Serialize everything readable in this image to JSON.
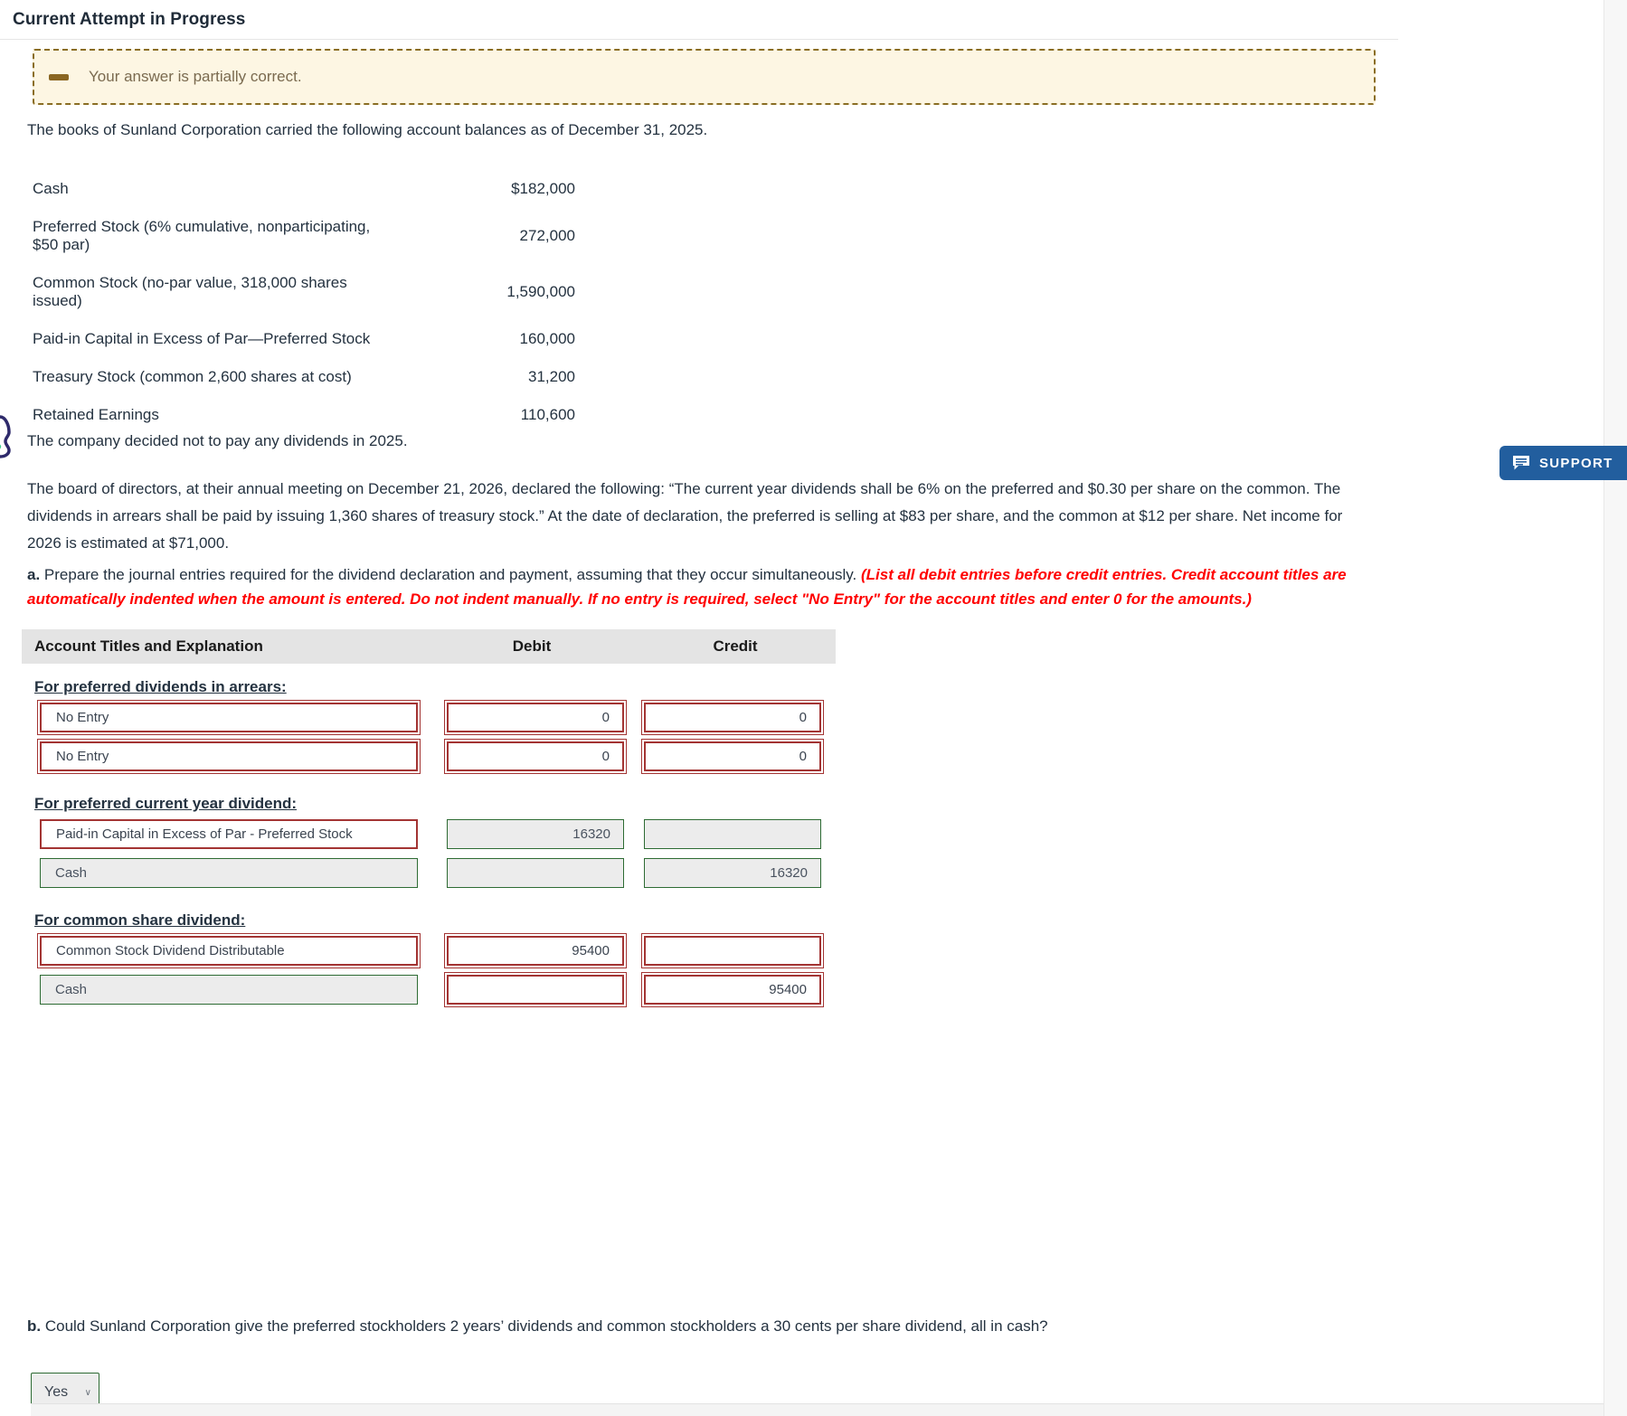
{
  "header": {
    "title": "Current Attempt in Progress"
  },
  "alert": {
    "icon": "minus-icon",
    "message": "Your answer is partially correct."
  },
  "intro": "The books of Sunland Corporation carried the following account balances as of December 31, 2025.",
  "balances": {
    "rows": [
      {
        "label": "Cash",
        "amount": "$182,000"
      },
      {
        "label": "Preferred Stock (6% cumulative, nonparticipating, $50 par)",
        "amount": "272,000"
      },
      {
        "label": "Common Stock (no-par value, 318,000 shares issued)",
        "amount": "1,590,000"
      },
      {
        "label": "Paid-in Capital in Excess of Par—Preferred Stock",
        "amount": "160,000"
      },
      {
        "label": "Treasury Stock (common 2,600 shares at cost)",
        "amount": "31,200"
      },
      {
        "label": "Retained Earnings",
        "amount": "110,600"
      }
    ]
  },
  "support": {
    "label": "SUPPORT",
    "icon": "speech-bubble-icon",
    "color": "#225e9e"
  },
  "cookie_widget": {
    "icon": "cookie-icon"
  },
  "paragraphs": {
    "no_dividends": "The company decided not to pay any dividends in 2025.",
    "board": "The board of directors, at their annual meeting on December 21, 2026, declared the following: “The current year dividends shall be 6% on the preferred and $0.30 per share on the common. The dividends in arrears shall be paid by issuing 1,360 shares of treasury stock.” At the date of declaration, the preferred is selling at $83 per share, and the common at $12 per share. Net income for 2026 is estimated at $71,000.",
    "question_a_prefix": "a.",
    "question_a_main": " Prepare the journal entries required for the dividend declaration and payment, assuming that they occur simultaneously. ",
    "question_a_hint": "(List all debit entries before credit entries. Credit account titles are automatically indented when the amount is entered. Do not indent manually. If no entry is required, select \"No Entry\" for the account titles and enter 0 for the amounts.)"
  },
  "journal": {
    "headers": {
      "account": "Account Titles and Explanation",
      "debit": "Debit",
      "credit": "Credit"
    },
    "sections": [
      {
        "label": "For preferred dividends in arrears:",
        "rows": [
          {
            "account": "No Entry",
            "account_state": "error",
            "debit": "0",
            "debit_state": "error",
            "credit": "0",
            "credit_state": "error"
          },
          {
            "account": "No Entry",
            "account_state": "error",
            "debit": "0",
            "debit_state": "error",
            "credit": "0",
            "credit_state": "error"
          }
        ]
      },
      {
        "label": "For preferred current year dividend:",
        "rows": [
          {
            "account": "Paid-in Capital in Excess of Par - Preferred Stock",
            "account_state": "error-single",
            "debit": "16320",
            "debit_state": "ok",
            "credit": "",
            "credit_state": "ok"
          },
          {
            "account": "Cash",
            "account_state": "ok",
            "debit": "",
            "debit_state": "ok",
            "credit": "16320",
            "credit_state": "ok"
          }
        ]
      },
      {
        "label": "For common share dividend:",
        "rows": [
          {
            "account": "Common Stock Dividend Distributable",
            "account_state": "error",
            "debit": "95400",
            "debit_state": "error",
            "credit": "",
            "credit_state": "error"
          },
          {
            "account": "Cash",
            "account_state": "ok",
            "debit": "",
            "debit_state": "error",
            "credit": "95400",
            "credit_state": "error"
          }
        ]
      }
    ]
  },
  "question_b": {
    "prefix": "b.",
    "text": " Could Sunland Corporation give the preferred stockholders 2 years’ dividends and common stockholders a 30 cents per share dividend, all in cash?",
    "answer": "Yes",
    "caret": "∨"
  }
}
